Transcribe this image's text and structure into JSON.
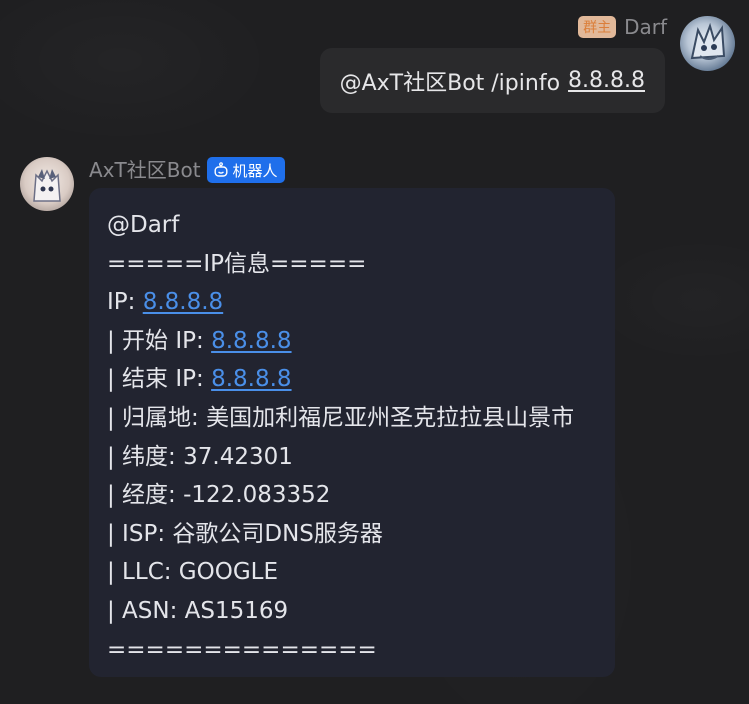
{
  "outgoing_message": {
    "role_badge": "群主",
    "sender": "Darf",
    "command": "@AxT社区Bot /ipinfo",
    "ip": "8.8.8.8"
  },
  "incoming_message": {
    "sender": "AxT社区Bot",
    "bot_badge": "机器人",
    "lines": {
      "mention": "@Darf",
      "header": "=====IP信息=====",
      "ip_label": "IP: ",
      "ip_value": "8.8.8.8",
      "start_ip_label": "| 开始 IP: ",
      "start_ip_value": "8.8.8.8",
      "end_ip_label": "| 结束 IP: ",
      "end_ip_value": "8.8.8.8",
      "location": "| 归属地: 美国加利福尼亚州圣克拉拉县山景市",
      "latitude": "| 纬度: 37.42301",
      "longitude": "| 经度: -122.083352",
      "isp": "| ISP: 谷歌公司DNS服务器",
      "llc": "| LLC: GOOGLE",
      "asn": "| ASN: AS15169",
      "footer": "=============="
    }
  },
  "colors": {
    "background": "#1f1f21",
    "bubble_out": "#2a2a2c",
    "bubble_in": "#222430",
    "link": "#4a8fe8",
    "bot_badge": "#1f6feb",
    "role_badge_bg": "#f7c9a6",
    "role_badge_text": "#f08a3e"
  },
  "icons": {
    "bot_badge_icon": "robot-icon",
    "avatar_darf": "avatar",
    "avatar_bot": "avatar"
  }
}
